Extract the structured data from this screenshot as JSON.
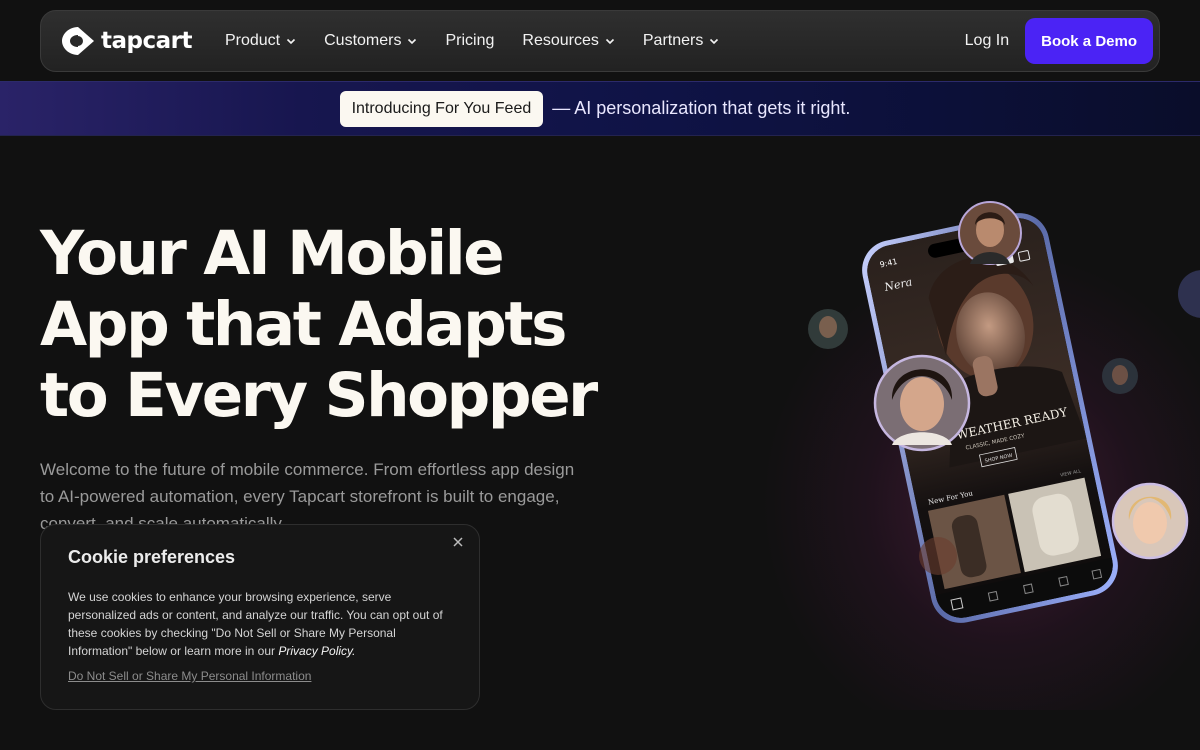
{
  "nav": {
    "logo_text": "tapcart",
    "items": [
      {
        "label": "Product",
        "has_dropdown": true
      },
      {
        "label": "Customers",
        "has_dropdown": true
      },
      {
        "label": "Pricing",
        "has_dropdown": false
      },
      {
        "label": "Resources",
        "has_dropdown": true
      },
      {
        "label": "Partners",
        "has_dropdown": true
      }
    ],
    "login_label": "Log In",
    "demo_label": "Book a Demo"
  },
  "announcement": {
    "pill": "Introducing For You Feed",
    "text": "— AI personalization that gets it right."
  },
  "hero": {
    "title_line1": "Your AI Mobile",
    "title_line2": "App that Adapts",
    "title_line3": "to Every Shopper",
    "subtitle": "Welcome to the future of mobile commerce. From effortless app design to AI-powered automation, every Tapcart storefront is built to engage, convert, and scale automatically."
  },
  "phone": {
    "time": "9:41",
    "brand": "Nera",
    "headline": "COLD WEATHER READY",
    "subline": "CLASSIC, MADE COZY",
    "cta": "SHOP NOW",
    "section": "New For You",
    "view_all": "VIEW ALL"
  },
  "cookie": {
    "title": "Cookie preferences",
    "body": "We use cookies to enhance your browsing experience, serve personalized ads or content, and analyze our traffic. You can opt out of these cookies by checking \"Do Not Sell or Share My Personal Information\" below or learn more in our",
    "privacy_link": "Privacy Policy.",
    "opt_out_link": "Do Not Sell or Share My Personal Information"
  },
  "colors": {
    "accent": "#4b23f5",
    "background": "#111111",
    "text_primary": "#fbf8f1",
    "text_muted": "#9a9a9a"
  },
  "icons": [
    "tapcart-logo-icon",
    "chevron-down-icon",
    "close-icon"
  ]
}
